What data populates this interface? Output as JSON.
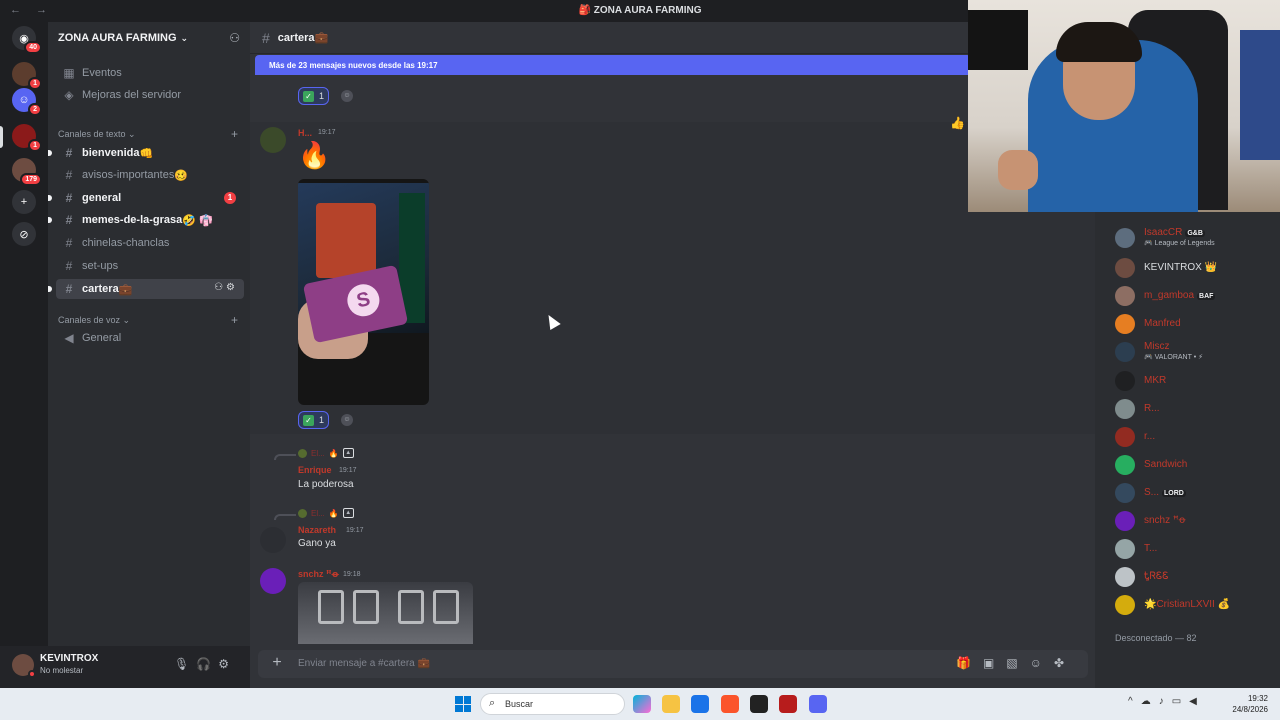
{
  "window": {
    "title": "🎒 ZONA AURA FARMING",
    "nav_arrows": "← →"
  },
  "rail": {
    "home_badge": "40",
    "servers": [
      {
        "badge": "1"
      },
      {
        "badge": "2"
      },
      {
        "badge": "1"
      },
      {
        "badge": "179"
      }
    ],
    "add_label": "+",
    "discover_label": "⊘"
  },
  "guild": {
    "name": "ZONA AURA FARMING",
    "top_items": [
      "Eventos",
      "Mejoras del servidor"
    ],
    "text_category": "Canales de texto",
    "voice_category": "Canales de voz",
    "text_channels": [
      {
        "name": "bienvenida",
        "emoji": "👊",
        "unread": true
      },
      {
        "name": "avisos-importantes",
        "emoji": "🥴",
        "unread": false
      },
      {
        "name": "general",
        "emoji": "",
        "unread": true,
        "mentions": "1"
      },
      {
        "name": "memes-de-la-grasa",
        "emoji": "🤣 👘",
        "unread": true
      },
      {
        "name": "chinelas-chanclas",
        "emoji": "",
        "unread": false
      },
      {
        "name": "set-ups",
        "emoji": "",
        "unread": false
      },
      {
        "name": "cartera",
        "emoji": "💼",
        "unread": false,
        "selected": true
      }
    ],
    "voice_channels": [
      {
        "name": "General"
      }
    ]
  },
  "user": {
    "name": "KEVINTROX",
    "status": "No molestar"
  },
  "channel": {
    "name": "cartera",
    "emoji": "💼",
    "new_messages_bar": "Más de 23 mensajes nuevos desde las 19:17"
  },
  "messages": {
    "reaction_count_1": "1",
    "fire_author": "H...",
    "fire_time": "19:17",
    "fire_emoji": "🔥",
    "reaction_count_2": "1",
    "reply1_name": "Enrique",
    "reply1_time": "19:17",
    "reply1_text": "La poderosa",
    "reply_mini_name": "El...",
    "reply2_name": "Nazareth",
    "reply2_time": "19:17",
    "reply2_text": "Gano ya",
    "last_author": "snchz ꟸꝋ",
    "last_time": "19:18"
  },
  "composer": {
    "placeholder": "Enviar mensaje a #cartera 💼"
  },
  "members": {
    "online": [
      {
        "name": "IsaacCR",
        "tag": "G&B",
        "sub": "🎮 League of Legends",
        "color": "#c0392b"
      },
      {
        "name": "KEVINTROX 👑",
        "tag": "",
        "sub": "",
        "color": "#dbdee1"
      },
      {
        "name": "m_gamboa",
        "tag": "BAF",
        "sub": "",
        "color": "#c0392b"
      },
      {
        "name": "Manfred",
        "tag": "",
        "sub": "",
        "color": "#c0392b"
      },
      {
        "name": "Miscz",
        "tag": "",
        "sub": "🎮 VALORANT • ⚡",
        "color": "#c0392b"
      },
      {
        "name": "MKR",
        "tag": "",
        "sub": "",
        "color": "#c0392b"
      },
      {
        "name": "R...",
        "tag": "",
        "sub": "",
        "color": "#c0392b"
      },
      {
        "name": "r...",
        "tag": "",
        "sub": "",
        "color": "#c0392b"
      },
      {
        "name": "Sandwich",
        "tag": "",
        "sub": "",
        "color": "#c0392b"
      },
      {
        "name": "S...",
        "tag": "LORD",
        "sub": "",
        "color": "#c0392b"
      },
      {
        "name": "snchz ꟸꝋ",
        "tag": "",
        "sub": "",
        "color": "#c0392b"
      },
      {
        "name": "T...",
        "tag": "",
        "sub": "",
        "color": "#c0392b"
      },
      {
        "name": "ᎿᏒᏋᏋ",
        "tag": "",
        "sub": "",
        "color": "#c0392b"
      },
      {
        "name": "🌟CristianLXVII 💰",
        "tag": "",
        "sub": "",
        "color": "#c0392b"
      }
    ],
    "offline_header": "Desconectado — 82"
  },
  "taskbar": {
    "search_label": "Buscar",
    "time": "19:32",
    "date": "24/8/2026"
  }
}
